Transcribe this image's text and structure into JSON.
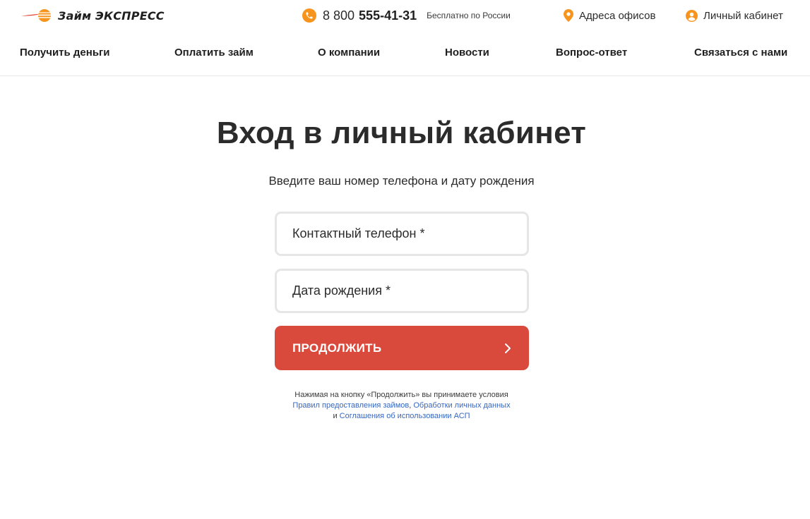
{
  "brand": {
    "name": "Займ ЭКСПРЕСС",
    "accent": "#f7941d",
    "cta_color": "#d94a3d",
    "link_color": "#3567c4"
  },
  "header": {
    "phone_icon": "phone-icon",
    "phone_prefix": "8 800",
    "phone_number": "555-41-31",
    "phone_note": "Бесплатно по России",
    "offices_icon": "map-pin-icon",
    "offices_label": "Адреса офисов",
    "cabinet_icon": "user-icon",
    "cabinet_label": "Личный кабинет"
  },
  "nav": {
    "items": [
      {
        "label": "Получить деньги"
      },
      {
        "label": "Оплатить займ"
      },
      {
        "label": "О компании"
      },
      {
        "label": "Новости"
      },
      {
        "label": "Вопрос-ответ"
      },
      {
        "label": "Связаться с нами"
      }
    ]
  },
  "main": {
    "title": "Вход в личный кабинет",
    "subtitle": "Введите ваш номер телефона и дату рождения",
    "phone_placeholder": "Контактный телефон *",
    "dob_placeholder": "Дата рождения *",
    "submit_label": "ПРОДОЛЖИТЬ",
    "submit_icon": "chevron-right-icon"
  },
  "legal": {
    "line1": "Нажимая на кнопку «Продолжить» вы принимаете условия",
    "link_loans": "Правил предоставления займов",
    "separator": ",",
    "link_data": "Обработки личных данных",
    "conjunction": "и",
    "link_asp": "Соглашения об использовании АСП"
  }
}
